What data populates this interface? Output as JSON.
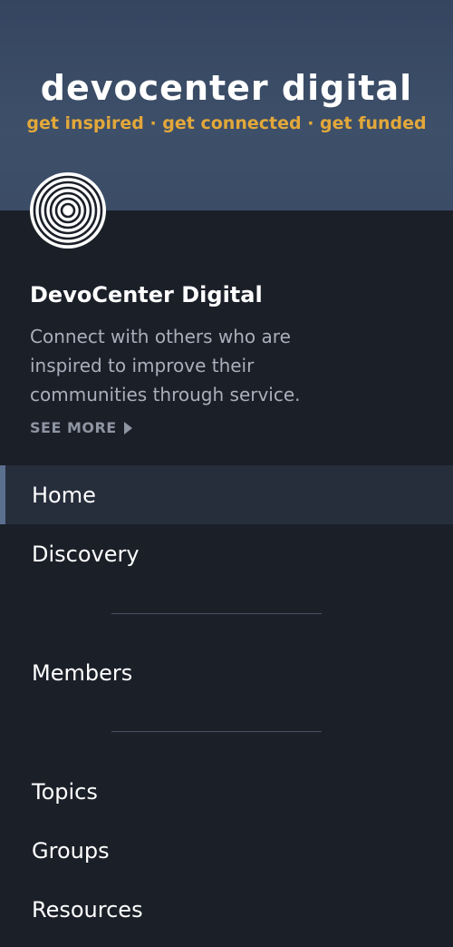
{
  "banner": {
    "title": "devocenter digital",
    "tagline": "get inspired · get connected · get funded"
  },
  "community": {
    "logo_icon": "concentric-circles-logo-icon",
    "name": "DevoCenter Digital",
    "description": "Connect with others who are inspired to improve their communities through service.",
    "see_more_label": "SEE MORE",
    "see_more_icon": "caret-right-icon"
  },
  "nav": {
    "items": [
      {
        "label": "Home",
        "active": true
      },
      {
        "label": "Discovery",
        "active": false
      },
      {
        "label": "Members",
        "active": false
      },
      {
        "label": "Topics",
        "active": false
      },
      {
        "label": "Groups",
        "active": false
      },
      {
        "label": "Resources",
        "active": false
      }
    ]
  },
  "colors": {
    "banner_bg": "#3a4b64",
    "tagline": "#e3a83a",
    "sidebar_bg": "#1b1f28",
    "active_bg": "#262d3b",
    "active_indicator": "#5b6f8f",
    "muted_text": "#a9afbb"
  }
}
